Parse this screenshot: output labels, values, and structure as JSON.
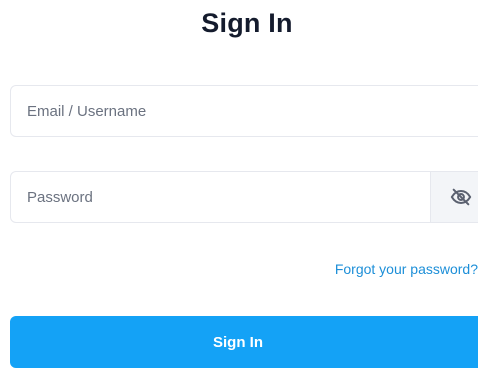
{
  "form": {
    "title": "Sign In",
    "email": {
      "value": "",
      "placeholder": "Email / Username"
    },
    "password": {
      "value": "",
      "placeholder": "Password",
      "toggle_icon": "eye-off-icon"
    },
    "forgot_link": "Forgot your password?",
    "submit_label": "Sign In"
  },
  "colors": {
    "accent": "#14a2f6",
    "link": "#1d8fd8",
    "title": "#141b2d"
  }
}
